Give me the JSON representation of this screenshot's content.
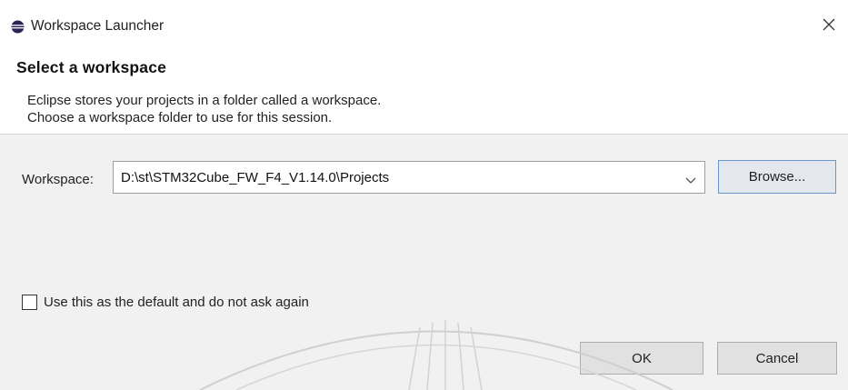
{
  "window": {
    "title": "Workspace Launcher",
    "icons": {
      "app": "eclipse-icon",
      "close": "close-icon"
    }
  },
  "header": {
    "title": "Select a workspace",
    "description_line1": "Eclipse stores your projects in a folder called a workspace.",
    "description_line2": "Choose a workspace folder to use for this session."
  },
  "workspace": {
    "label": "Workspace:",
    "value": "D:\\st\\STM32Cube_FW_F4_V1.14.0\\Projects",
    "dropdown_icon": "chevron-down-icon"
  },
  "buttons": {
    "browse": "Browse...",
    "ok": "OK",
    "cancel": "Cancel"
  },
  "default_checkbox": {
    "label": "Use this as the default and do not ask again",
    "checked": false
  },
  "colors": {
    "accent_border": "#6a97c8",
    "button_bg": "#e1e1e1",
    "body_bg": "#f1f1f1"
  }
}
